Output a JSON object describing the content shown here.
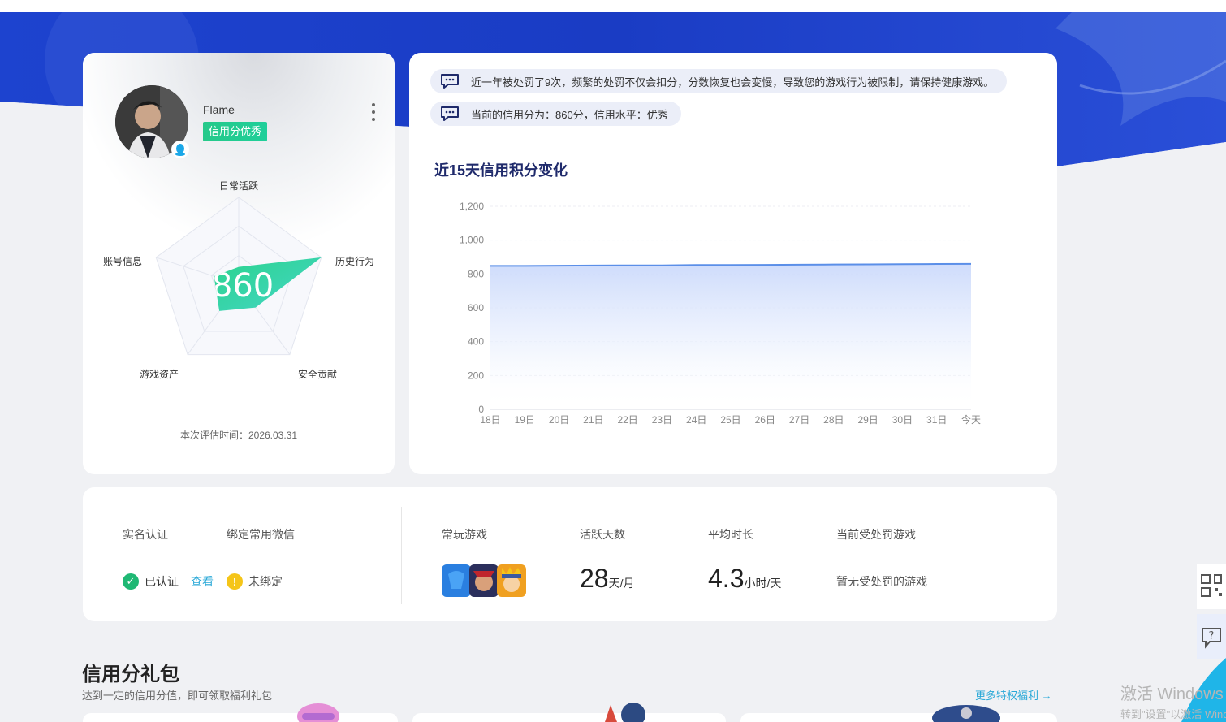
{
  "profile": {
    "username": "Flame",
    "credit_tag": "信用分优秀",
    "score": "860",
    "radar_labels": {
      "top": "日常活跃",
      "right": "历史行为",
      "bottom_right": "安全贡献",
      "bottom_left": "游戏资产",
      "left": "账号信息"
    },
    "radar_values": [
      0.2,
      1.0,
      0.33,
      0.38,
      0.3
    ],
    "eval_label": "本次评估时间：",
    "eval_date": "2026.03.31"
  },
  "notices": [
    "近一年被处罚了9次，频繁的处罚不仅会扣分，分数恢复也会变慢，导致您的游戏行为被限制，请保持健康游戏。",
    "当前的信用分为：860分，信用水平：优秀"
  ],
  "chart_title": "近15天信用积分变化",
  "chart_data": {
    "type": "area",
    "title": "近15天信用积分变化",
    "categories": [
      "18日",
      "19日",
      "20日",
      "21日",
      "22日",
      "23日",
      "24日",
      "25日",
      "26日",
      "27日",
      "28日",
      "29日",
      "30日",
      "31日",
      "今天"
    ],
    "values": [
      848,
      848,
      849,
      850,
      851,
      851,
      853,
      853,
      854,
      855,
      856,
      857,
      858,
      859,
      860
    ],
    "y_ticks": [
      "0",
      "200",
      "400",
      "600",
      "800",
      "1,000",
      "1,200"
    ],
    "ylim": [
      0,
      1200
    ],
    "grid": "horizontal dashed",
    "color": "#5b8fe8"
  },
  "stats": {
    "real_name_label": "实名认证",
    "wechat_label": "绑定常用微信",
    "verified_text": "已认证",
    "view_link": "查看",
    "unbound_text": "未绑定",
    "frequent_games_label": "常玩游戏",
    "active_days_label": "活跃天数",
    "active_days_value": "28",
    "active_days_unit": "天/月",
    "avg_time_label": "平均时长",
    "avg_time_value": "4.3",
    "avg_time_unit": "小时/天",
    "punished_label": "当前受处罚游戏",
    "punished_value": "暂无受处罚的游戏"
  },
  "gift": {
    "title": "信用分礼包",
    "subtitle": "达到一定的信用分值，即可领取福利礼包",
    "more_link": "更多特权福利 →"
  },
  "watermark": {
    "line1": "激活 Windows",
    "line2": "转到\"设置\"以激活 Windows。"
  },
  "colors": {
    "hero_blue": "#1c3ec9",
    "accent_green": "#2bd38c",
    "link_blue": "#28a8d7",
    "chart_line": "#5b8fe8"
  }
}
